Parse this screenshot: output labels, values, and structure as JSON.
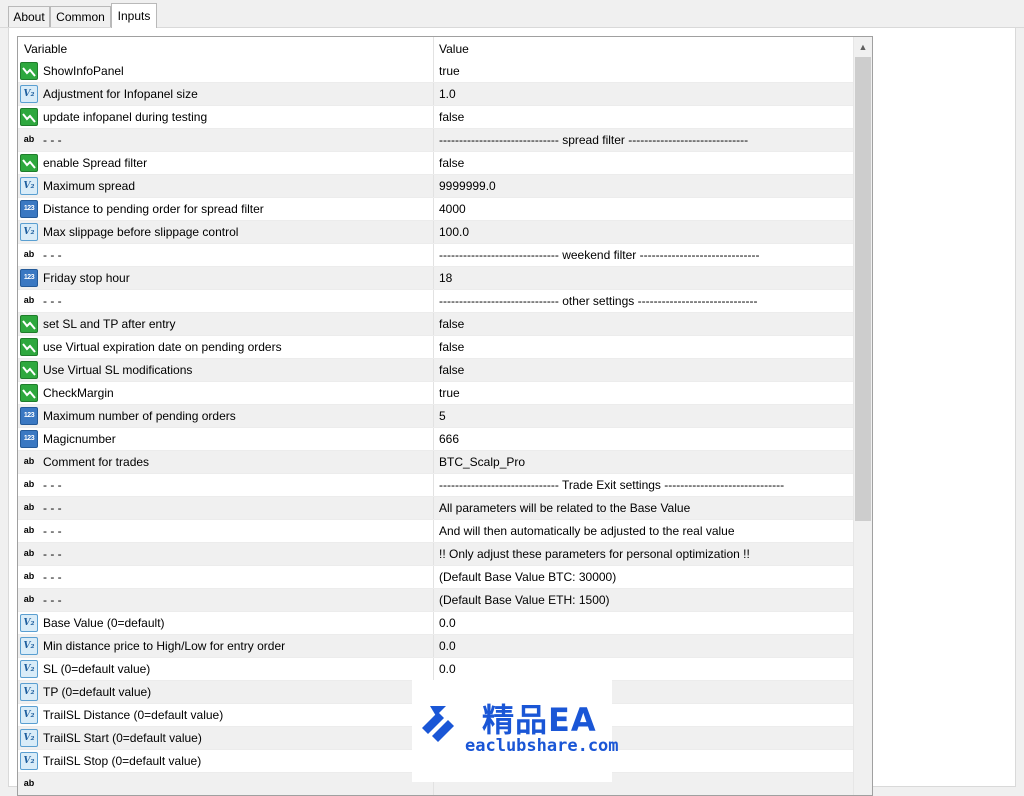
{
  "tabs": [
    {
      "label": "About",
      "active": false
    },
    {
      "label": "Common",
      "active": false
    },
    {
      "label": "Inputs",
      "active": true
    }
  ],
  "table": {
    "headers": {
      "variable": "Variable",
      "value": "Value"
    },
    "rows": [
      {
        "icon": "bool-icon",
        "type": "bool",
        "name": "ShowInfoPanel",
        "value": "true"
      },
      {
        "icon": "double-icon",
        "type": "double",
        "name": "Adjustment for Infopanel size",
        "value": "1.0"
      },
      {
        "icon": "bool-icon",
        "type": "bool",
        "name": "update infopanel during testing",
        "value": "false"
      },
      {
        "icon": "string-icon",
        "type": "string",
        "name": "- - -",
        "value": "------------------------------ spread filter ------------------------------"
      },
      {
        "icon": "bool-icon",
        "type": "bool",
        "name": "enable Spread filter",
        "value": "false"
      },
      {
        "icon": "double-icon",
        "type": "double",
        "name": "Maximum spread",
        "value": "9999999.0"
      },
      {
        "icon": "int-icon",
        "type": "int",
        "name": "Distance to pending order for spread filter",
        "value": "4000"
      },
      {
        "icon": "double-icon",
        "type": "double",
        "name": "Max slippage before slippage control",
        "value": "100.0"
      },
      {
        "icon": "string-icon",
        "type": "string",
        "name": "- - -",
        "value": "------------------------------ weekend filter ------------------------------"
      },
      {
        "icon": "int-icon",
        "type": "int",
        "name": "Friday stop hour",
        "value": "18"
      },
      {
        "icon": "string-icon",
        "type": "string",
        "name": "- - -",
        "value": "------------------------------ other settings ------------------------------"
      },
      {
        "icon": "bool-icon",
        "type": "bool",
        "name": "set SL and TP after entry",
        "value": "false"
      },
      {
        "icon": "bool-icon",
        "type": "bool",
        "name": "use Virtual expiration date on pending orders",
        "value": "false"
      },
      {
        "icon": "bool-icon",
        "type": "bool",
        "name": "Use Virtual SL modifications",
        "value": "false"
      },
      {
        "icon": "bool-icon",
        "type": "bool",
        "name": "CheckMargin",
        "value": "true"
      },
      {
        "icon": "int-icon",
        "type": "int",
        "name": "Maximum number of pending orders",
        "value": "5"
      },
      {
        "icon": "int-icon",
        "type": "int",
        "name": "Magicnumber",
        "value": "666"
      },
      {
        "icon": "string-icon",
        "type": "string",
        "name": "Comment for trades",
        "value": "BTC_Scalp_Pro"
      },
      {
        "icon": "string-icon",
        "type": "string",
        "name": "- - -",
        "value": "------------------------------ Trade Exit settings ------------------------------"
      },
      {
        "icon": "string-icon",
        "type": "string",
        "name": "- - -",
        "value": "All parameters will be related to the Base Value"
      },
      {
        "icon": "string-icon",
        "type": "string",
        "name": "- - -",
        "value": "And will then automatically be adjusted to the real value"
      },
      {
        "icon": "string-icon",
        "type": "string",
        "name": "- - -",
        "value": "!! Only adjust these parameters for personal optimization !!"
      },
      {
        "icon": "string-icon",
        "type": "string",
        "name": "- - -",
        "value": "(Default Base Value BTC: 30000)"
      },
      {
        "icon": "string-icon",
        "type": "string",
        "name": "- - -",
        "value": "(Default Base Value ETH: 1500)"
      },
      {
        "icon": "double-icon",
        "type": "double",
        "name": "Base Value (0=default)",
        "value": "0.0"
      },
      {
        "icon": "double-icon",
        "type": "double",
        "name": "Min distance price to High/Low for entry order",
        "value": "0.0"
      },
      {
        "icon": "double-icon",
        "type": "double",
        "name": "SL (0=default value)",
        "value": "0.0"
      },
      {
        "icon": "double-icon",
        "type": "double",
        "name": "TP (0=default value)",
        "value": ""
      },
      {
        "icon": "double-icon",
        "type": "double",
        "name": "TrailSL Distance (0=default value)",
        "value": ""
      },
      {
        "icon": "double-icon",
        "type": "double",
        "name": "TrailSL Start (0=default value)",
        "value": ""
      },
      {
        "icon": "double-icon",
        "type": "double",
        "name": "TrailSL Stop (0=default value)",
        "value": ""
      },
      {
        "icon": "string-icon",
        "type": "string",
        "name": "",
        "value": ""
      }
    ]
  },
  "icon_glyphs": {
    "double": "V₂",
    "int": "123",
    "string": "ab"
  },
  "watermark": {
    "title": "精品EA",
    "url": "eaclubshare.com"
  },
  "colors": {
    "watermark_blue": "#1a56d6",
    "bool_icon": "#2ea83e",
    "int_icon": "#3a78c2",
    "string_icon": "#f2dc7d"
  }
}
